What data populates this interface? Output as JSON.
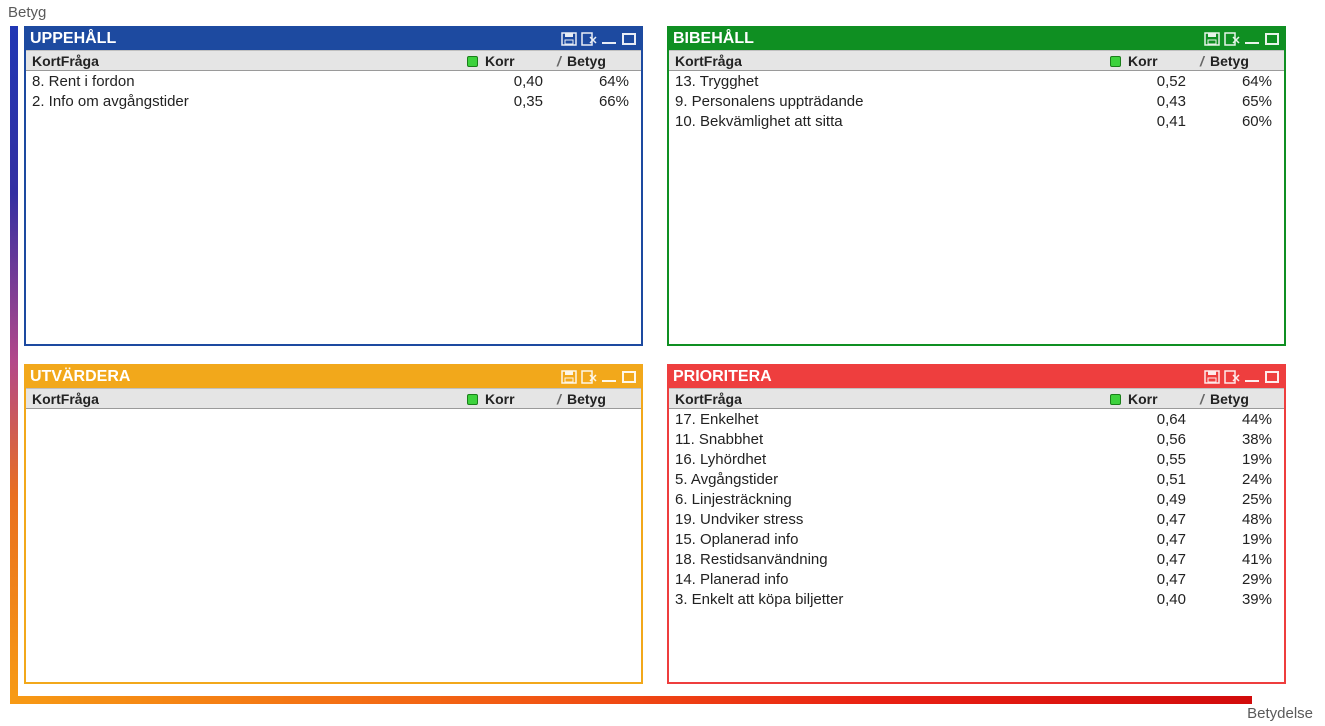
{
  "axis_y_label": "Betyg",
  "axis_x_label": "Betydelse",
  "col_q_label": "KortFråga",
  "col_k_label": "Korr",
  "col_sep_char": "/",
  "col_b_label": "Betyg",
  "panels": {
    "uppehall": {
      "title": "UPPEHÅLL",
      "rows": [
        {
          "q": "8. Rent i fordon",
          "korr": "0,40",
          "betyg": "64%"
        },
        {
          "q": "2. Info om avgångstider",
          "korr": "0,35",
          "betyg": "66%"
        }
      ]
    },
    "bibehall": {
      "title": "BIBEHÅLL",
      "rows": [
        {
          "q": "13. Trygghet",
          "korr": "0,52",
          "betyg": "64%"
        },
        {
          "q": "9. Personalens uppträdande",
          "korr": "0,43",
          "betyg": "65%"
        },
        {
          "q": "10. Bekvämlighet att sitta",
          "korr": "0,41",
          "betyg": "60%"
        }
      ]
    },
    "utvardera": {
      "title": "UTVÄRDERA",
      "rows": []
    },
    "prioritera": {
      "title": "PRIORITERA",
      "rows": [
        {
          "q": "17. Enkelhet",
          "korr": "0,64",
          "betyg": "44%"
        },
        {
          "q": "11. Snabbhet",
          "korr": "0,56",
          "betyg": "38%"
        },
        {
          "q": "16. Lyhördhet",
          "korr": "0,55",
          "betyg": "19%"
        },
        {
          "q": "5. Avgångstider",
          "korr": "0,51",
          "betyg": "24%"
        },
        {
          "q": "6. Linjesträckning",
          "korr": "0,49",
          "betyg": "25%"
        },
        {
          "q": "19. Undviker stress",
          "korr": "0,47",
          "betyg": "48%"
        },
        {
          "q": "15. Oplanerad info",
          "korr": "0,47",
          "betyg": "19%"
        },
        {
          "q": "18. Restidsanvändning",
          "korr": "0,47",
          "betyg": "41%"
        },
        {
          "q": "14. Planerad info",
          "korr": "0,47",
          "betyg": "29%"
        },
        {
          "q": "3. Enkelt att köpa biljetter",
          "korr": "0,40",
          "betyg": "39%"
        }
      ]
    }
  }
}
